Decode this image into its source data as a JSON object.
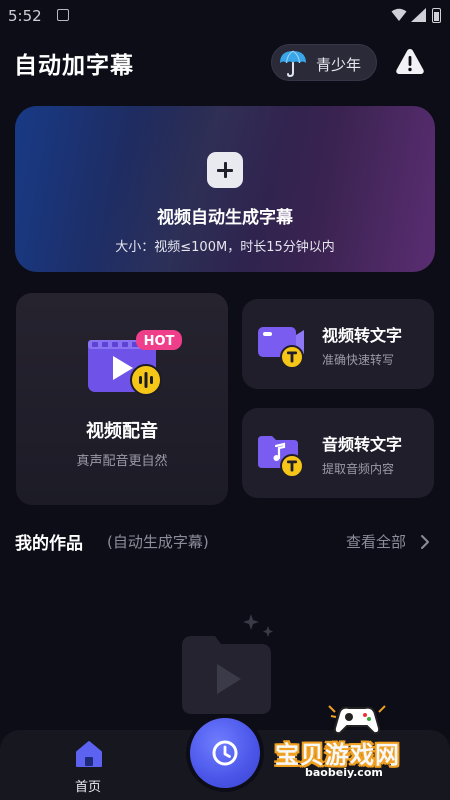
{
  "status_bar": {
    "time": "5:52"
  },
  "header": {
    "title": "自动加字幕",
    "teen_mode_label": "青少年"
  },
  "hero": {
    "title": "视频自动生成字幕",
    "subtitle": "大小：视频≤100M，时长15分钟以内"
  },
  "dubbing": {
    "badge": "HOT",
    "title": "视频配音",
    "subtitle": "真声配音更自然"
  },
  "video_to_text": {
    "title": "视频转文字",
    "subtitle": "准确快速转写"
  },
  "audio_to_text": {
    "title": "音频转文字",
    "subtitle": "提取音频内容"
  },
  "works": {
    "title": "我的作品",
    "subtitle": "(自动生成字幕)",
    "view_all": "查看全部"
  },
  "bottom_nav": {
    "home_label": "首页"
  },
  "watermark": {
    "text": "宝贝游戏网",
    "url": "baobeiy.com"
  },
  "colors": {
    "accent": "#5b63f0",
    "icon_purple": "#7a5cf0",
    "badge_pink": "#ef3f8a",
    "badge_yellow": "#f5c518"
  }
}
